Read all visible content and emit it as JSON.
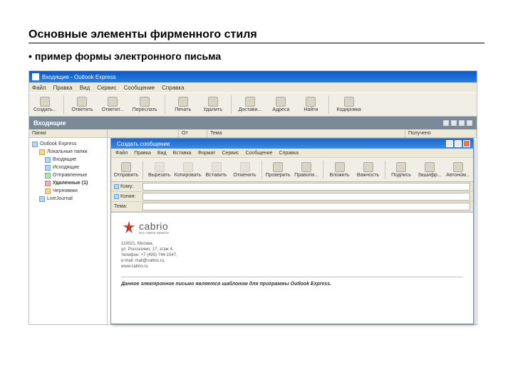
{
  "slide": {
    "title": "Основные элементы фирменного стиля",
    "bullet": "•",
    "subtitle": "пример формы электронного письма"
  },
  "main_window": {
    "title": "Входящие - Outlook Express",
    "menu": [
      "Файл",
      "Правка",
      "Вид",
      "Сервис",
      "Сообщение",
      "Справка"
    ],
    "toolbar": [
      {
        "label": "Создать...",
        "icon": "new"
      },
      {
        "label": "Ответить",
        "icon": "reply"
      },
      {
        "label": "Ответит...",
        "icon": "replyall"
      },
      {
        "label": "Переслать",
        "icon": "forward"
      },
      {
        "label": "Печать",
        "icon": "print"
      },
      {
        "label": "Удалить",
        "icon": "delete"
      },
      {
        "label": "Достави...",
        "icon": "sendrecv"
      },
      {
        "label": "Адреса",
        "icon": "addresses"
      },
      {
        "label": "Найти",
        "icon": "find"
      },
      {
        "label": "Кодировка",
        "icon": "encoding"
      }
    ],
    "folder_title": "Входящие"
  },
  "sidebar": {
    "header": "Папки",
    "items": [
      {
        "label": "Outlook Express",
        "bold": false,
        "indent": 0,
        "icon": "blue"
      },
      {
        "label": "Локальные папки",
        "bold": false,
        "indent": 1,
        "icon": "yellow"
      },
      {
        "label": "Входящие",
        "bold": false,
        "indent": 2,
        "icon": "blue"
      },
      {
        "label": "Исходящие",
        "bold": false,
        "indent": 2,
        "icon": "blue"
      },
      {
        "label": "Отправленные",
        "bold": false,
        "indent": 2,
        "icon": "green"
      },
      {
        "label": "Удаленные (1)",
        "bold": true,
        "indent": 2,
        "icon": "red"
      },
      {
        "label": "Черновики",
        "bold": false,
        "indent": 2,
        "icon": "yellow"
      },
      {
        "label": "LiveJournal",
        "bold": false,
        "indent": 1,
        "icon": "blue"
      }
    ]
  },
  "list_columns": {
    "c1": "",
    "c2": "От",
    "c3": "Тема",
    "c4": "Получено"
  },
  "compose": {
    "title": "Создать сообщение",
    "menu": [
      "Файл",
      "Правка",
      "Вид",
      "Вставка",
      "Формат",
      "Сервис",
      "Сообщение",
      "Справка"
    ],
    "toolbar": [
      {
        "label": "Отправить",
        "icon": "send",
        "enabled": true
      },
      {
        "label": "Вырезать",
        "icon": "cut",
        "enabled": false
      },
      {
        "label": "Копировать",
        "icon": "copy",
        "enabled": false
      },
      {
        "label": "Вставить",
        "icon": "paste",
        "enabled": false
      },
      {
        "label": "Отменить",
        "icon": "undo",
        "enabled": false
      },
      {
        "label": "Проверить",
        "icon": "check",
        "enabled": true
      },
      {
        "label": "Правопи...",
        "icon": "spell",
        "enabled": true
      },
      {
        "label": "Вложить",
        "icon": "attach",
        "enabled": true
      },
      {
        "label": "Важность",
        "icon": "priority",
        "enabled": true
      },
      {
        "label": "Подпись",
        "icon": "sign",
        "enabled": true
      },
      {
        "label": "Зашифр...",
        "icon": "encrypt",
        "enabled": true
      },
      {
        "label": "Автоном...",
        "icon": "offline",
        "enabled": true
      }
    ],
    "fields": {
      "to_label": "Кому:",
      "cc_label": "Копия:",
      "subj_label": "Тема:"
    }
  },
  "email_body": {
    "brand_name": "cabrio",
    "brand_tagline": "все самое важное",
    "address_line1": "119021, Москва,",
    "address_line2": "ул. Россолимо, 17, этаж 4,",
    "address_line3": "телефон: +7 (495) 744-1547,",
    "address_line4": "e-mail: mail@cabrio.ru,",
    "address_line5": "www.cabrio.ru",
    "template_note": "Данное электронное письмо является шаблоном для программы Outlook Express."
  }
}
